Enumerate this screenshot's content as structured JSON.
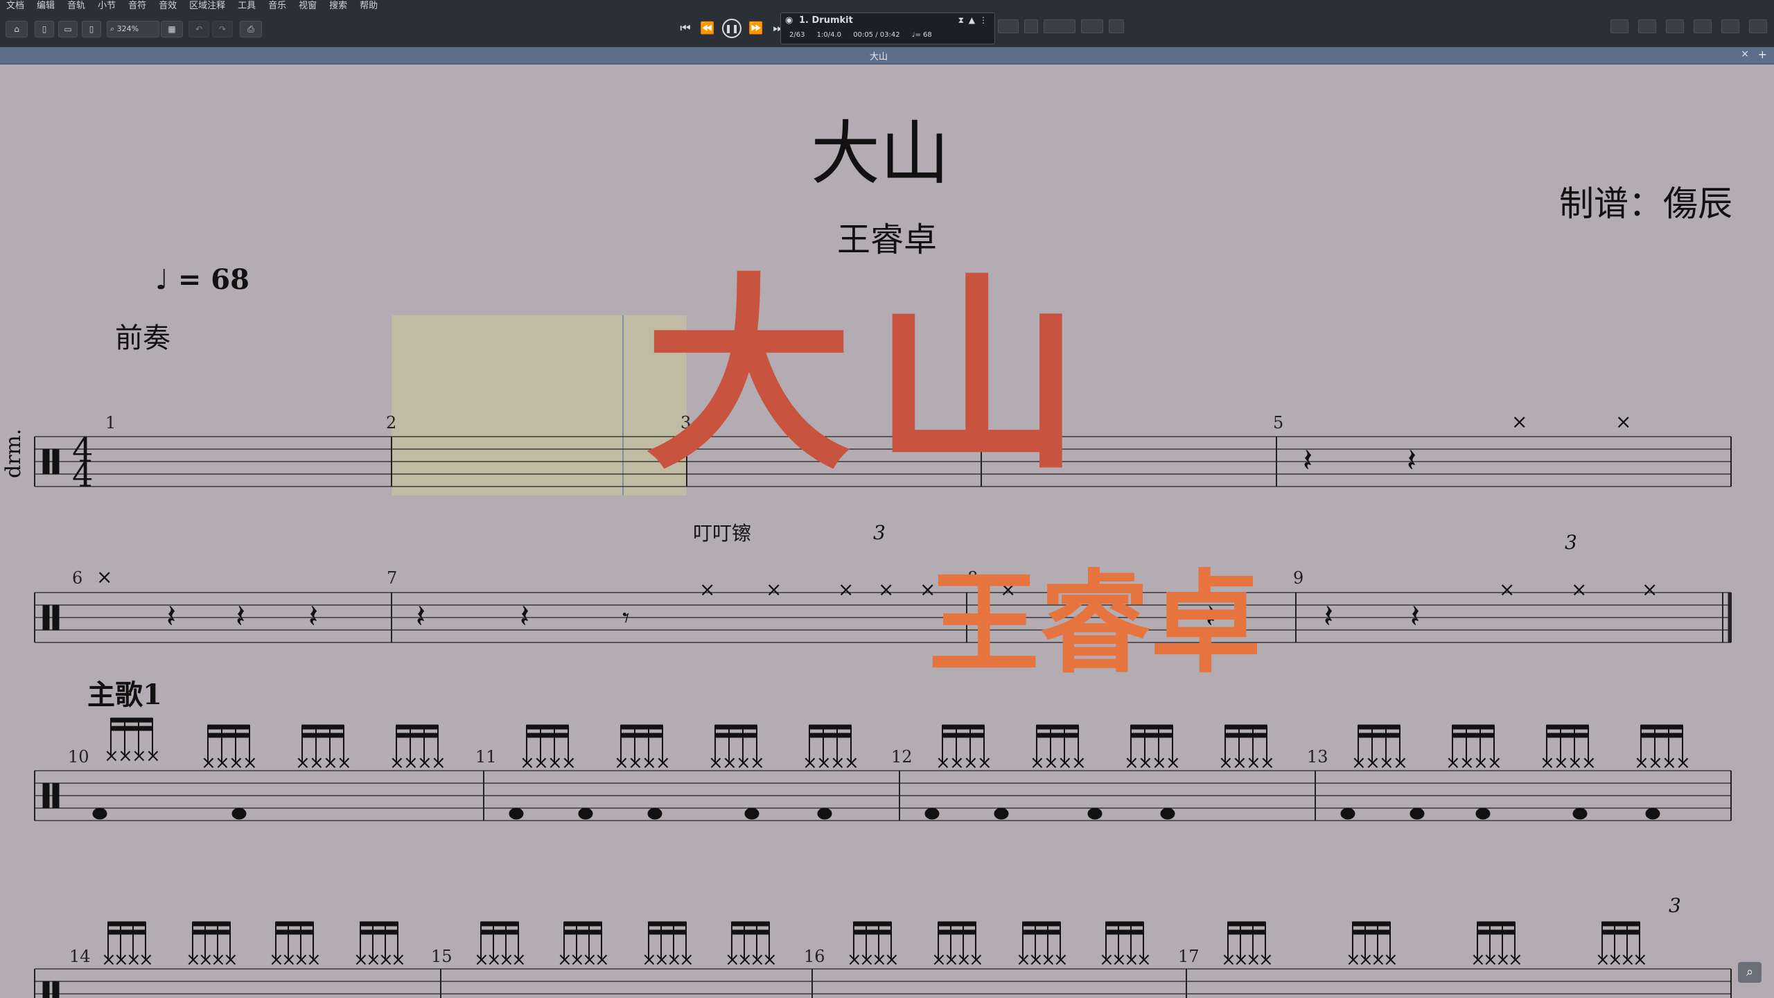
{
  "menu": [
    "文档",
    "编辑",
    "音轨",
    "小节",
    "音符",
    "音效",
    "区域注释",
    "工具",
    "音乐",
    "视窗",
    "搜索",
    "帮助"
  ],
  "toolbar": {
    "zoom": "324%"
  },
  "transport": {
    "track": "1. Drumkit",
    "bar_position": "2/63",
    "beat": "1:0/4.0",
    "time": "00:05 / 03:42",
    "tempo": "♩= 68"
  },
  "tab": {
    "title": "大山",
    "close": "×",
    "add": "+"
  },
  "score": {
    "title": "大山",
    "composer": "王睿卓",
    "arranger": "制谱：傷辰",
    "tempo": "= 68",
    "instrument": "drm.",
    "sections": [
      "前奏",
      "主歌1"
    ],
    "annotation": "叮叮镲",
    "tuplet": "3",
    "measure_numbers": [
      "1",
      "2",
      "3",
      "4",
      "5",
      "6",
      "7",
      "8",
      "9",
      "10",
      "11",
      "12",
      "13",
      "14",
      "15",
      "16",
      "17"
    ]
  },
  "watermark": {
    "title": "大山",
    "artist": "王睿卓",
    "title_color": "#c8533f",
    "artist_color": "#e6743f"
  },
  "zoom_fit_icon": "⌕"
}
